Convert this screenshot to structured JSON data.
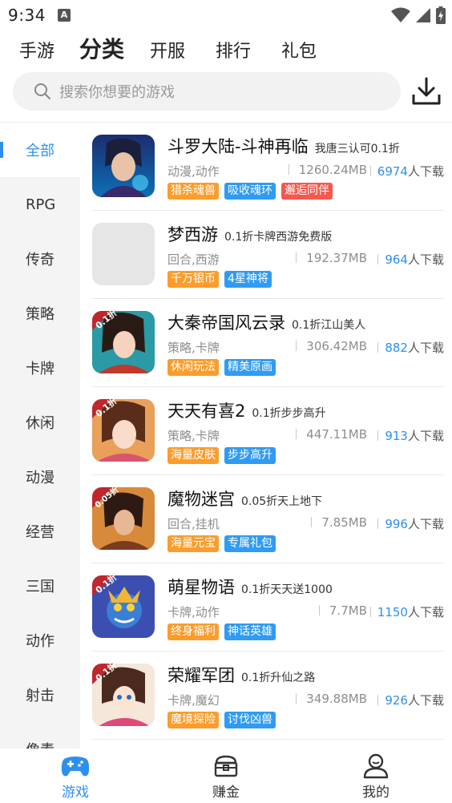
{
  "status": {
    "time": "9:34",
    "notif_letter": "A"
  },
  "top_tabs": [
    {
      "label": "手游"
    },
    {
      "label": "分类"
    },
    {
      "label": "开服"
    },
    {
      "label": "排行"
    },
    {
      "label": "礼包"
    }
  ],
  "active_top_tab": "分类",
  "search": {
    "placeholder": "搜索你想要的游戏"
  },
  "sidebar": {
    "items": [
      {
        "label": "全部"
      },
      {
        "label": "RPG"
      },
      {
        "label": "传奇"
      },
      {
        "label": "策略"
      },
      {
        "label": "卡牌"
      },
      {
        "label": "休闲"
      },
      {
        "label": "动漫"
      },
      {
        "label": "经营"
      },
      {
        "label": "三国"
      },
      {
        "label": "动作"
      },
      {
        "label": "射击"
      },
      {
        "label": "像素"
      }
    ],
    "active": "全部"
  },
  "games": [
    {
      "name": "斗罗大陆-斗神再临",
      "subtitle": "我唐三认可0.1折",
      "genre": "动漫,动作",
      "size": "1260.24MB",
      "downloads": "6974",
      "dl_suffix": "人下载",
      "tags": [
        {
          "text": "猎杀魂兽",
          "color": "#fb9d2c"
        },
        {
          "text": "吸收魂环",
          "color": "#2f9bf3"
        },
        {
          "text": "邂逅同伴",
          "color": "#f7574d"
        }
      ]
    },
    {
      "name": "梦西游",
      "subtitle": "0.1折卡牌西游免费版",
      "genre": "回合,西游",
      "size": "192.37MB",
      "downloads": "964",
      "dl_suffix": "人下载",
      "tags": [
        {
          "text": "千万银币",
          "color": "#fb9d2c"
        },
        {
          "text": "4星神将",
          "color": "#2f9bf3"
        }
      ]
    },
    {
      "name": "大秦帝国风云录",
      "subtitle": "0.1折江山美人",
      "genre": "策略,卡牌",
      "size": "306.42MB",
      "downloads": "882",
      "dl_suffix": "人下载",
      "tags": [
        {
          "text": "休闲玩法",
          "color": "#fb9d2c"
        },
        {
          "text": "精美原画",
          "color": "#2f9bf3"
        }
      ]
    },
    {
      "name": "天天有喜2",
      "subtitle": "0.1折步步高升",
      "genre": "策略,卡牌",
      "size": "447.11MB",
      "downloads": "913",
      "dl_suffix": "人下载",
      "tags": [
        {
          "text": "海量皮肤",
          "color": "#fb9d2c"
        },
        {
          "text": "步步高升",
          "color": "#2f9bf3"
        }
      ]
    },
    {
      "name": "魔物迷宫",
      "subtitle": "0.05折天上地下",
      "genre": "回合,挂机",
      "size": "7.85MB",
      "downloads": "996",
      "dl_suffix": "人下载",
      "tags": [
        {
          "text": "海量元宝",
          "color": "#fb9d2c"
        },
        {
          "text": "专属礼包",
          "color": "#2f9bf3"
        }
      ]
    },
    {
      "name": "萌星物语",
      "subtitle": "0.1折天天送1000",
      "genre": "卡牌,动作",
      "size": "7.7MB",
      "downloads": "1150",
      "dl_suffix": "人下载",
      "tags": [
        {
          "text": "终身福利",
          "color": "#fb9d2c"
        },
        {
          "text": "神话英雄",
          "color": "#2f9bf3"
        }
      ]
    },
    {
      "name": "荣耀军团",
      "subtitle": "0.1折升仙之路",
      "genre": "卡牌,魔幻",
      "size": "349.88MB",
      "downloads": "926",
      "dl_suffix": "人下载",
      "tags": [
        {
          "text": "魔境探险",
          "color": "#fb9d2c"
        },
        {
          "text": "讨伐凶兽",
          "color": "#2f9bf3"
        }
      ]
    }
  ],
  "icon_badges": [
    "",
    "",
    "0.1折",
    "0.1折",
    "0.05折",
    "0.1折",
    "0.1折"
  ],
  "bottom_nav": [
    {
      "label": "游戏",
      "icon": "gamepad-icon"
    },
    {
      "label": "赚金",
      "icon": "treasure-chest-icon"
    },
    {
      "label": "我的",
      "icon": "user-icon"
    }
  ],
  "active_bottom": "游戏",
  "colors": {
    "accent": "#2e8ff0",
    "tag_orange": "#fb9d2c",
    "tag_blue": "#2f9bf3",
    "tag_red": "#f7574d"
  }
}
